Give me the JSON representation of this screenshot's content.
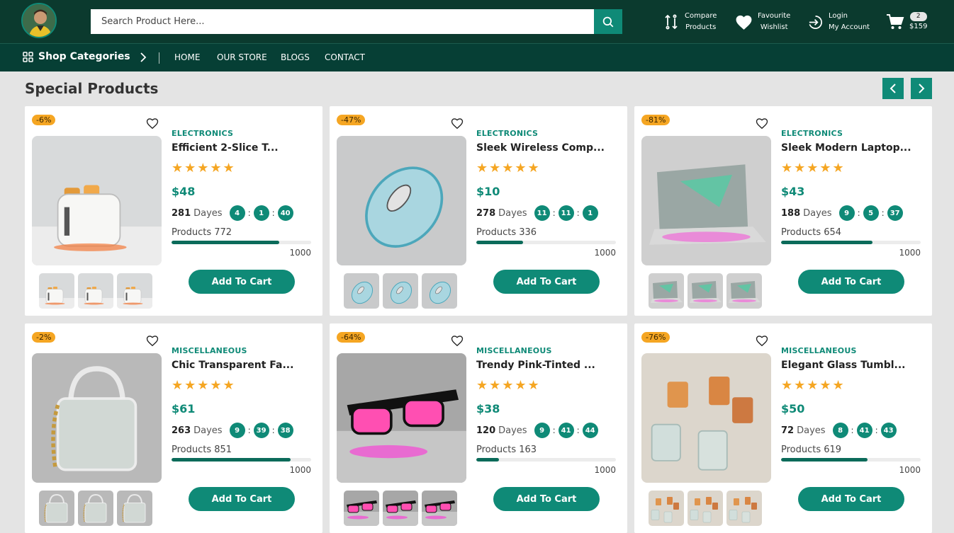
{
  "search": {
    "placeholder": "Search Product Here..."
  },
  "header": {
    "compare": {
      "line1": "Compare",
      "line2": "Products"
    },
    "wishlist": {
      "line1": "Favourite",
      "line2": "Wishlist"
    },
    "account": {
      "line1": "Login",
      "line2": "My Account"
    },
    "cart": {
      "count": "2",
      "total": "$159"
    }
  },
  "nav": {
    "categories_label": "Shop Categories",
    "items": [
      "HOME",
      "OUR STORE",
      "BLOGS",
      "CONTACT"
    ]
  },
  "section": {
    "title": "Special Products"
  },
  "colors": {
    "primary": "#0f8a77",
    "header": "#0b3a2e",
    "navbar": "#063f35",
    "badge": "#f5a623",
    "background": "#e4e4e4"
  },
  "products": [
    {
      "discount": "-6%",
      "category": "ELECTRONICS",
      "name": "Efficient 2-Slice T...",
      "stars": "★★★★★",
      "price": "$48",
      "days": "281",
      "days_label": "Dayes",
      "h": "4",
      "m": "1",
      "s": "40",
      "products_label": "Products 772",
      "sold_fraction": 0.772,
      "max": "1000",
      "button": "Add To Cart",
      "image": "toaster"
    },
    {
      "discount": "-47%",
      "category": "ELECTRONICS",
      "name": "Sleek Wireless Comp...",
      "stars": "★★★★★",
      "price": "$10",
      "days": "278",
      "days_label": "Dayes",
      "h": "11",
      "m": "11",
      "s": "1",
      "products_label": "Products 336",
      "sold_fraction": 0.336,
      "max": "1000",
      "button": "Add To Cart",
      "image": "mouse"
    },
    {
      "discount": "-81%",
      "category": "ELECTRONICS",
      "name": "Sleek Modern Laptop...",
      "stars": "★★★★★",
      "price": "$43",
      "days": "188",
      "days_label": "Dayes",
      "h": "9",
      "m": "5",
      "s": "37",
      "products_label": "Products 654",
      "sold_fraction": 0.654,
      "max": "1000",
      "button": "Add To Cart",
      "image": "laptop"
    },
    {
      "discount": "-2%",
      "category": "MISCELLANEOUS",
      "name": "Chic Transparent Fa...",
      "stars": "★★★★★",
      "price": "$61",
      "days": "263",
      "days_label": "Dayes",
      "h": "9",
      "m": "39",
      "s": "38",
      "products_label": "Products 851",
      "sold_fraction": 0.851,
      "max": "1000",
      "button": "Add To Cart",
      "image": "bag"
    },
    {
      "discount": "-64%",
      "category": "MISCELLANEOUS",
      "name": "Trendy Pink-Tinted ...",
      "stars": "★★★★★",
      "price": "$38",
      "days": "120",
      "days_label": "Dayes",
      "h": "9",
      "m": "41",
      "s": "44",
      "products_label": "Products 163",
      "sold_fraction": 0.163,
      "max": "1000",
      "button": "Add To Cart",
      "image": "glasses"
    },
    {
      "discount": "-76%",
      "category": "MISCELLANEOUS",
      "name": "Elegant Glass Tumbl...",
      "stars": "★★★★★",
      "price": "$50",
      "days": "72",
      "days_label": "Dayes",
      "h": "8",
      "m": "41",
      "s": "43",
      "products_label": "Products 619",
      "sold_fraction": 0.619,
      "max": "1000",
      "button": "Add To Cart",
      "image": "tumbler"
    }
  ]
}
